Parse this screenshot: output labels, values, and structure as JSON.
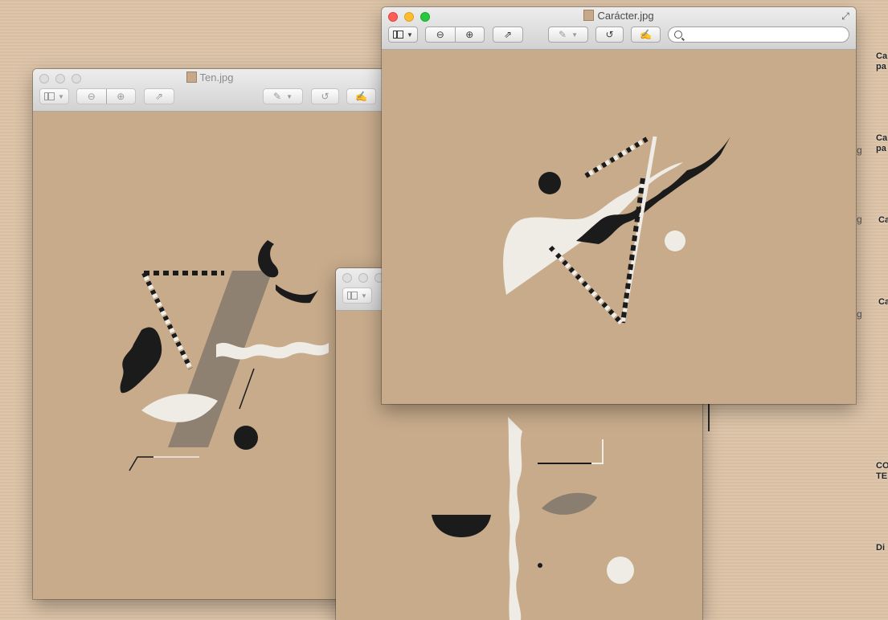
{
  "desktop": {
    "labels": [
      "Ca\npa",
      "Ca\npa",
      "Ca",
      "Ca",
      "CO\nTE",
      "Di"
    ],
    "fragments": [
      "g",
      "g",
      "g"
    ]
  },
  "windows": {
    "ten": {
      "title": "Ten.jpg"
    },
    "third": {
      "title": ""
    },
    "caracter": {
      "title": "Carácter.jpg",
      "search_placeholder": ""
    }
  },
  "icons": {
    "sidebar": "sidebar-icon",
    "zoom_out": "zoom-out-icon",
    "zoom_in": "zoom-in-icon",
    "share": "share-icon",
    "markup": "pen-icon",
    "rotate": "rotate-icon",
    "edit": "edit-icon",
    "search": "search-icon",
    "fullscreen": "fullscreen-icon"
  },
  "colors": {
    "paper": "#c7ab8b",
    "desktop": "#dcc3a6",
    "ink": "#1b1b1b",
    "chalk": "#efece6"
  }
}
